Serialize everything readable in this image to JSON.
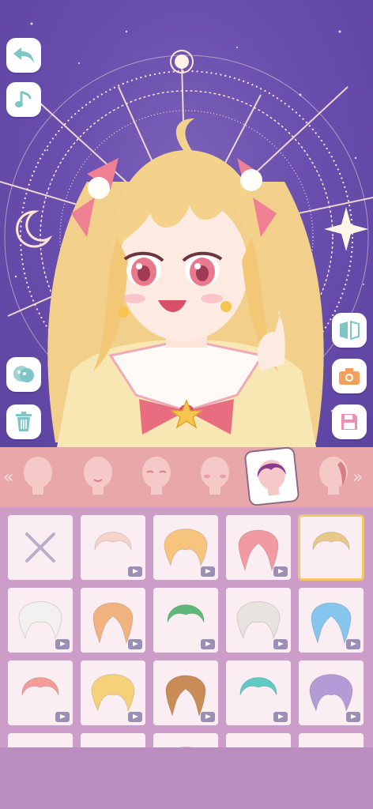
{
  "app": {
    "screen": "character-maker"
  },
  "toolbar": {
    "left": [
      {
        "name": "back-button",
        "icon": "undo-arrow-icon"
      },
      {
        "name": "music-button",
        "icon": "music-note-icon"
      },
      {
        "name": "background-button",
        "icon": "mask-icon"
      },
      {
        "name": "delete-button",
        "icon": "trash-icon"
      }
    ],
    "right": [
      {
        "name": "flip-button",
        "icon": "mirror-icon"
      },
      {
        "name": "camera-button",
        "icon": "camera-icon"
      },
      {
        "name": "save-button",
        "icon": "floppy-icon"
      }
    ]
  },
  "categories": [
    {
      "name": "face-shape",
      "icon": "head-outline-icon"
    },
    {
      "name": "mouth",
      "icon": "mouth-icon"
    },
    {
      "name": "eyes",
      "icon": "eyes-icon"
    },
    {
      "name": "blush",
      "icon": "blush-icon"
    },
    {
      "name": "hair",
      "icon": "hair-icon",
      "active": true
    },
    {
      "name": "side-hair",
      "icon": "side-hair-icon"
    }
  ],
  "hair_items": [
    {
      "type": "none"
    },
    {
      "color": "#f6d3c9",
      "video": true
    },
    {
      "color": "#f7c47e",
      "video": true
    },
    {
      "color": "#f29aa2",
      "video": true
    },
    {
      "color": "#e9c988",
      "selected": true
    },
    {
      "color": "#f2f1ef",
      "video": true
    },
    {
      "color": "#f0b27f",
      "video": true
    },
    {
      "color": "#5fb87b",
      "video": true
    },
    {
      "color": "#e9e3e0",
      "video": true
    },
    {
      "color": "#86c6ee",
      "video": true
    },
    {
      "color": "#f39c98",
      "video": true
    },
    {
      "color": "#f5d27a",
      "video": true
    },
    {
      "color": "#c98c57",
      "video": true
    },
    {
      "color": "#5fc9c4",
      "video": true
    },
    {
      "color": "#b49ad6",
      "video": true
    },
    {
      "color": "#f2c46d"
    },
    {
      "color": "#ef9f80"
    },
    {
      "color": "#f3b0c5"
    },
    {
      "color": "#e8e3e3"
    },
    {
      "color": "#4a4a4a"
    }
  ],
  "colors": {
    "stage_bg": "#6a4fae",
    "strip": "#e8a7a9",
    "grid_bg": "#cc9dc8",
    "tile": "#fbeef3",
    "button_icon": "#7fc5c6",
    "save_icon": "#ee8fb5",
    "camera_icon": "#f0a15d"
  }
}
